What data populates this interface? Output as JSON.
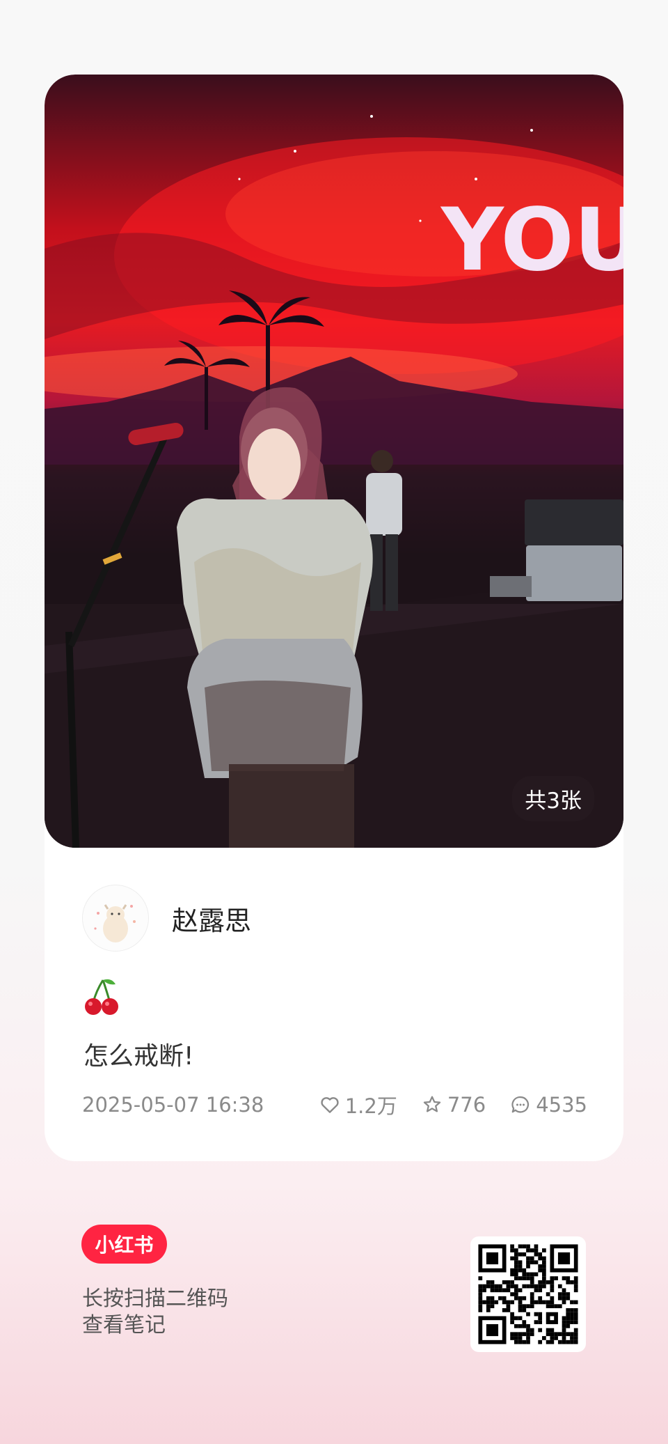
{
  "note": {
    "image_count_label": "共3张",
    "screen_text": "YOU",
    "author": {
      "name": "赵露思"
    },
    "emoji": "cherries",
    "title": "怎么戒断!",
    "date": "2025-05-07 16:38",
    "stats": {
      "likes": "1.2万",
      "collects": "776",
      "comments": "4535"
    }
  },
  "footer": {
    "brand": "小红书",
    "scan_line1": "长按扫描二维码",
    "scan_line2": "查看笔记"
  },
  "colors": {
    "brand": "#ff2442",
    "card": "#ffffff",
    "meta_text": "#8a8a8a"
  },
  "icons": [
    "heart-icon",
    "star-icon",
    "comment-icon",
    "qr-code",
    "avatar"
  ]
}
